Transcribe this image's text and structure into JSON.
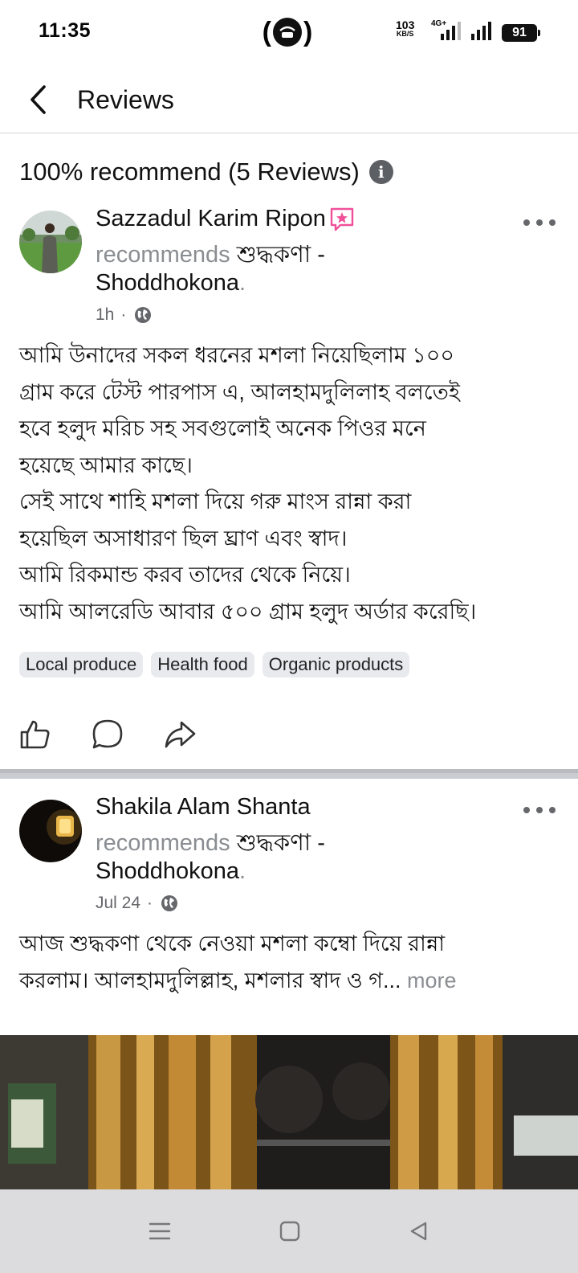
{
  "status_bar": {
    "time": "11:35",
    "speed_value": "103",
    "speed_unit": "KB/S",
    "network": "4G+",
    "battery": "91"
  },
  "header": {
    "title": "Reviews",
    "back_icon": "chevron-left-icon"
  },
  "summary": {
    "text": "100% recommend (5 Reviews)",
    "info_icon_glyph": "i"
  },
  "reviews": [
    {
      "name": "Sazzadul Karim Ripon",
      "badge_icon": "top-fan-badge-icon",
      "recommends_word": "recommends",
      "page_name_bn": "শুদ্ধকণা -",
      "page_name_en": "Shoddhokona",
      "period": ".",
      "time": "1h",
      "separator": "·",
      "text_lines": [
        "আমি উনাদের সকল ধরনের মশলা নিয়েছিলাম ১০০",
        "গ্রাম করে টেস্ট পারপাস এ, আলহামদুলিলাহ বলতেই",
        "হবে হলুদ মরিচ সহ সবগুলোই অনেক পিওর মনে",
        "হয়েছে আমার কাছে।",
        "সেই সাথে শাহি মশলা দিয়ে গরু মাংস রান্না করা",
        "হয়েছিল অসাধারণ ছিল ঘ্রাণ এবং স্বাদ।",
        "আমি রিকমান্ড করব তাদের থেকে নিয়ে।",
        "আমি আলরেডি আবার ৫০০ গ্রাম হলুদ অর্ডার করেছি।"
      ],
      "tags": [
        "Local produce",
        "Health food",
        "Organic products"
      ]
    },
    {
      "name": "Shakila Alam Shanta",
      "recommends_word": "recommends",
      "page_name_bn": "শুদ্ধকণা -",
      "page_name_en": "Shoddhokona",
      "period": ".",
      "time": "Jul 24",
      "separator": "·",
      "text_line_1": "আজ শুদ্ধকণা থেকে নেওয়া মশলা কম্বো দিয়ে রান্না",
      "text_line_2": "করলাম। আলহামদুলিল্লাহ, মশলার স্বাদ ও গ...",
      "more_label": "more"
    }
  ],
  "colors": {
    "secondary_text": "#8a8d91",
    "tag_background": "#e9eaee",
    "divider": "#c9ccd1",
    "navbar": "#dcdcdf"
  }
}
